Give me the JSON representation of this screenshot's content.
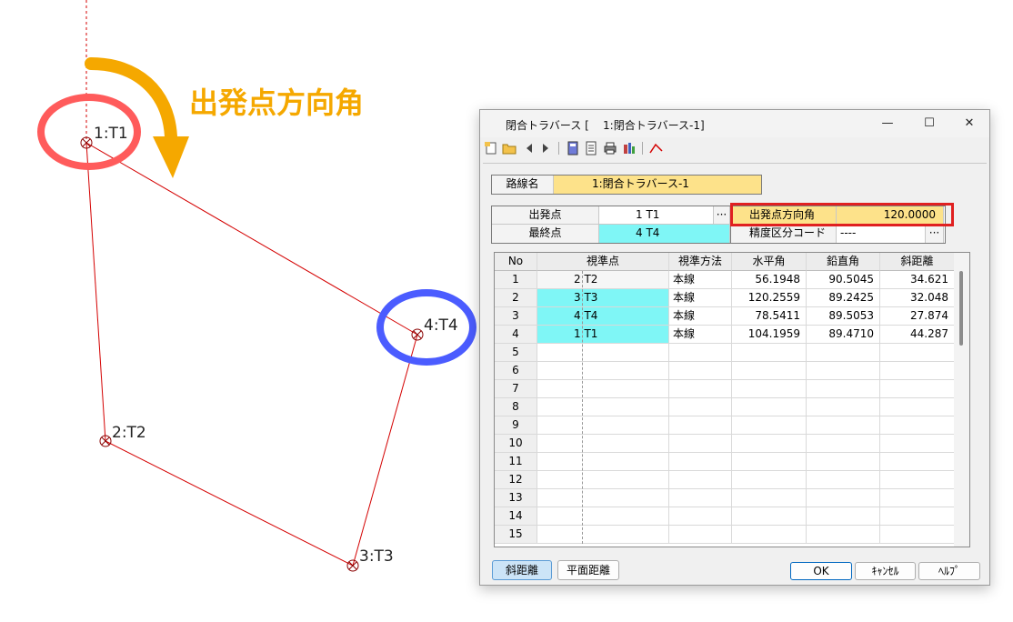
{
  "overlay": {
    "title": "出発点方向角",
    "accent_orange": "#f5a800",
    "accent_red": "#ff5b5b",
    "accent_blue": "#4b5cff"
  },
  "drawing": {
    "points": [
      {
        "label": "1:T1"
      },
      {
        "label": "2:T2"
      },
      {
        "label": "3:T3"
      },
      {
        "label": "4:T4"
      }
    ],
    "line_color": "#d40000"
  },
  "dialog": {
    "title": "閉合トラバース [    1:閉合トラバース-1]",
    "window_buttons": {
      "minimize": "—",
      "maximize": "☐",
      "close": "✕"
    },
    "toolbar": [
      "new-icon",
      "open-icon",
      "prev-icon",
      "next-icon",
      "calc-icon",
      "document-icon",
      "print-icon",
      "settings-icon",
      "polyline-icon"
    ],
    "route": {
      "label": "路線名",
      "value": "1:閉合トラバース-1"
    },
    "start": {
      "label": "出発点",
      "value": "1 T1",
      "dots": "···"
    },
    "end": {
      "label": "最終点",
      "value": "4 T4"
    },
    "direction": {
      "label": "出発点方向角",
      "value": "120.0000"
    },
    "precision": {
      "label": "精度区分コード",
      "value": "----",
      "dots": "···"
    },
    "columns": [
      "No",
      "視準点",
      "視準方法",
      "水平角",
      "鉛直角",
      "斜距離"
    ],
    "rows": [
      {
        "no": "1",
        "point": "2 T2",
        "method": "本線",
        "h": "56.1948",
        "v": "90.5045",
        "d": "34.621"
      },
      {
        "no": "2",
        "point": "3 T3",
        "method": "本線",
        "h": "120.2559",
        "v": "89.2425",
        "d": "32.048"
      },
      {
        "no": "3",
        "point": "4 T4",
        "method": "本線",
        "h": "78.5411",
        "v": "89.5053",
        "d": "27.874"
      },
      {
        "no": "4",
        "point": "1 T1",
        "method": "本線",
        "h": "104.1959",
        "v": "89.4710",
        "d": "44.287"
      },
      {
        "no": "5"
      },
      {
        "no": "6"
      },
      {
        "no": "7"
      },
      {
        "no": "8"
      },
      {
        "no": "9"
      },
      {
        "no": "10"
      },
      {
        "no": "11"
      },
      {
        "no": "12"
      },
      {
        "no": "13"
      },
      {
        "no": "14"
      },
      {
        "no": "15"
      }
    ],
    "buttons": {
      "slope": "斜距離",
      "plane": "平面距離",
      "ok": "OK",
      "cancel": "ｷｬﾝｾﾙ",
      "help": "ﾍﾙﾌﾟ"
    }
  }
}
